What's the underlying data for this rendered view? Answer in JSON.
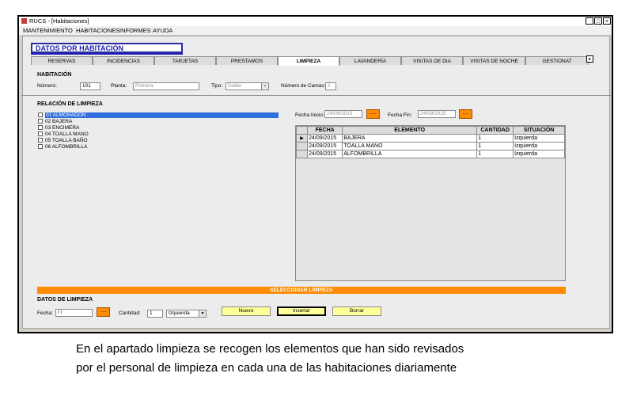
{
  "window": {
    "title": "RUCS - [Habitaciones]",
    "min": "_",
    "max": "□",
    "close": "×"
  },
  "menu": [
    "MANTENIMIENTO",
    "HABITACIONES",
    "INFORMES",
    "AYUDA"
  ],
  "header": {
    "title": "DATOS POR HABITACIÓN"
  },
  "tabs": [
    {
      "label": "RESERVAS"
    },
    {
      "label": "INCIDENCIAS"
    },
    {
      "label": "TARJETAS"
    },
    {
      "label": "PRESTAMOS"
    },
    {
      "label": "LIMPIEZA",
      "active": true
    },
    {
      "label": "LAVANDERÍA"
    },
    {
      "label": "VISITAS DE DIA"
    },
    {
      "label": "VISITAS DE NOCHE"
    },
    {
      "label": "GESTIONAT"
    }
  ],
  "tab_scroll": "▸",
  "habitacion": {
    "section_title": "HABITACIÓN",
    "numero_label": "Número:",
    "numero_value": "101",
    "planta_label": "Planta:",
    "planta_value": "Primera",
    "tipo_label": "Tipo:",
    "tipo_value": "Doble",
    "camas_label": "Número de Camas:",
    "camas_value": "2"
  },
  "relacion": {
    "section_title": "RELACIÓN DE LIMPIEZA",
    "items": [
      {
        "label": "01  ALMOHADON",
        "selected": true
      },
      {
        "label": "02  BAJERA"
      },
      {
        "label": "03  ENCIMERA"
      },
      {
        "label": "04  TOALLA MANO"
      },
      {
        "label": "05  TOALLA BAÑO"
      },
      {
        "label": "06  ALFOMBRILLA"
      }
    ]
  },
  "filtro": {
    "fecha_inicio_label": "Fecha Inicio:",
    "fecha_inicio_value": "24/09/2015",
    "fecha_fin_label": "Fecha Fin:",
    "fecha_fin_value": "24/09/2015",
    "picker_label": "....."
  },
  "grid": {
    "columns": [
      "FECHA",
      "ELEMENTO",
      "CANTIDAD",
      "SITUACIÓN"
    ],
    "row_marker": "▶",
    "rows": [
      [
        "24/09/2015",
        "BAJERA",
        "1",
        "Izquierda"
      ],
      [
        "24/09/2015",
        "TOALLA MANO",
        "1",
        "Izquierda"
      ],
      [
        "24/09/2015",
        "ALFOMBRILLA",
        "1",
        "Izquierda"
      ]
    ]
  },
  "select_bar": "SELECCIONAR LIMPIEZA",
  "datos": {
    "section_title": "DATOS DE LIMPIEZA",
    "fecha_label": "Fecha:",
    "fecha_value": " / /",
    "picker_label": ".....",
    "cantidad_label": "Cantidad:",
    "cantidad_value": "1",
    "situacion_value": "Izquierda"
  },
  "buttons": {
    "nuevo": "Nuevo",
    "insertar": "Insertar",
    "borrar": "Borrar"
  },
  "caption": {
    "line1": "En el apartado limpieza se recogen los elementos que han sido revisados",
    "line2": "por el personal de limpieza en cada una de las habitaciones diariamente"
  },
  "colors": {
    "accent_orange": "#ff8c00",
    "selection_blue": "#2f6fde",
    "header_blue": "#1e1eb4",
    "button_yellow": "#ffff99"
  }
}
